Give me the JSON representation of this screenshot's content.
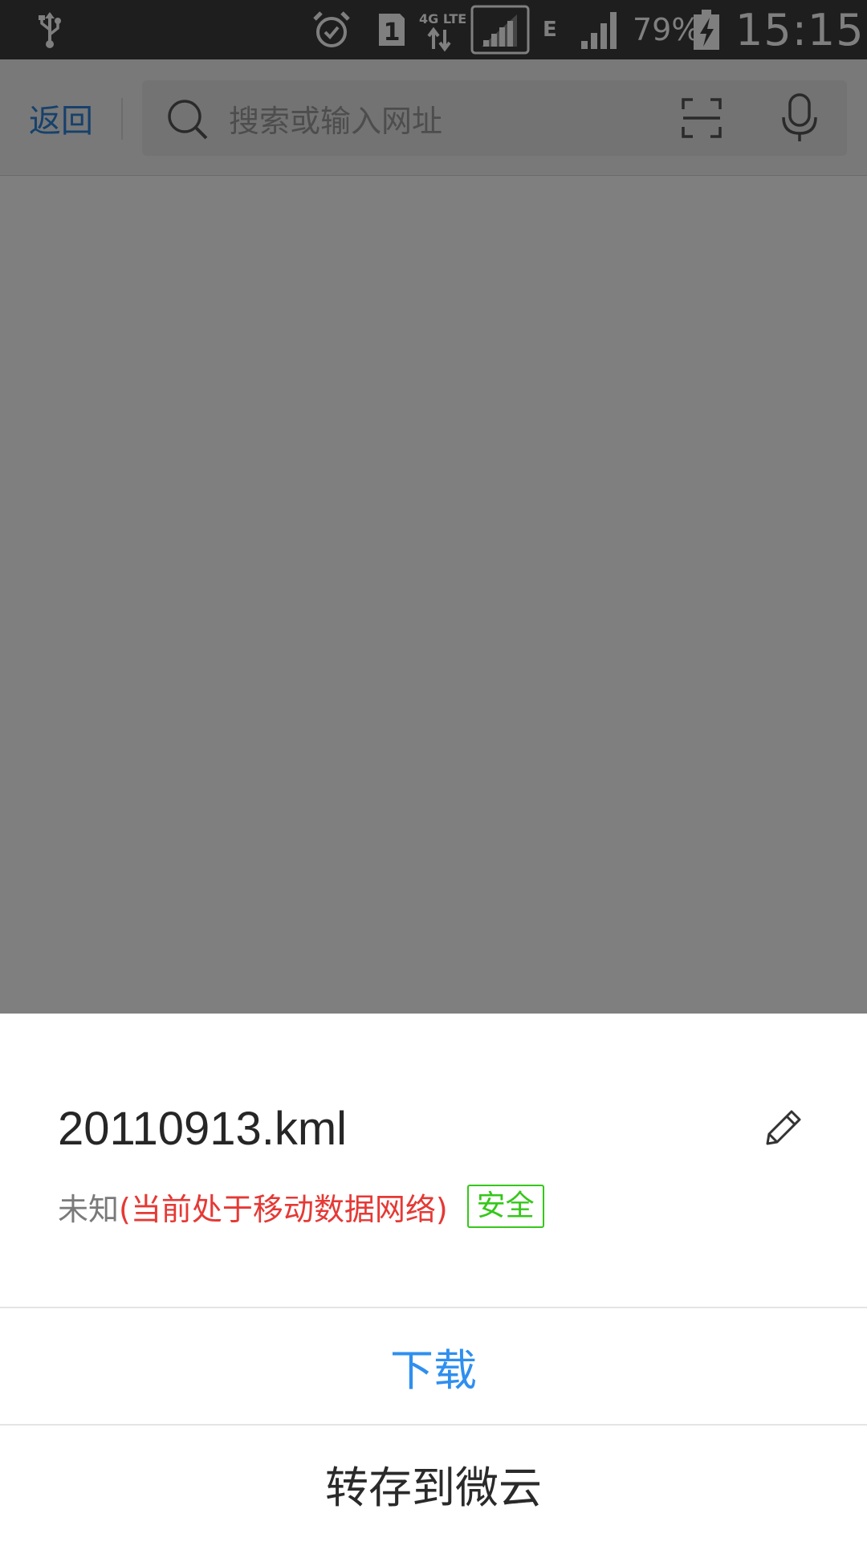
{
  "status_bar": {
    "icons": [
      "usb-icon",
      "alarm-icon",
      "sim1-icon",
      "data-transfer-icon",
      "signal-icon",
      "signal-icon",
      "battery-charging-icon"
    ],
    "network_4g": "4G LTE",
    "sim_slot": "1",
    "network_e": "E",
    "battery_percent": "79%",
    "time": "15:15"
  },
  "browser_bar": {
    "back_label": "返回",
    "search_placeholder": "搜索或输入网址",
    "icons": [
      "search-icon",
      "scan-icon",
      "microphone-icon"
    ]
  },
  "download_sheet": {
    "file_name": "20110913.kml",
    "size_label": "未知",
    "network_notice": "(当前处于移动数据网络)",
    "safe_badge": "安全",
    "download_label": "下载",
    "save_to_weiyun_label": "转存到微云",
    "icons": [
      "edit-icon"
    ]
  },
  "colors": {
    "status_bar_bg": "#3d3d3d",
    "accent_blue": "#2f8fef",
    "warning_red": "#e53935",
    "safe_green": "#35c71a"
  }
}
